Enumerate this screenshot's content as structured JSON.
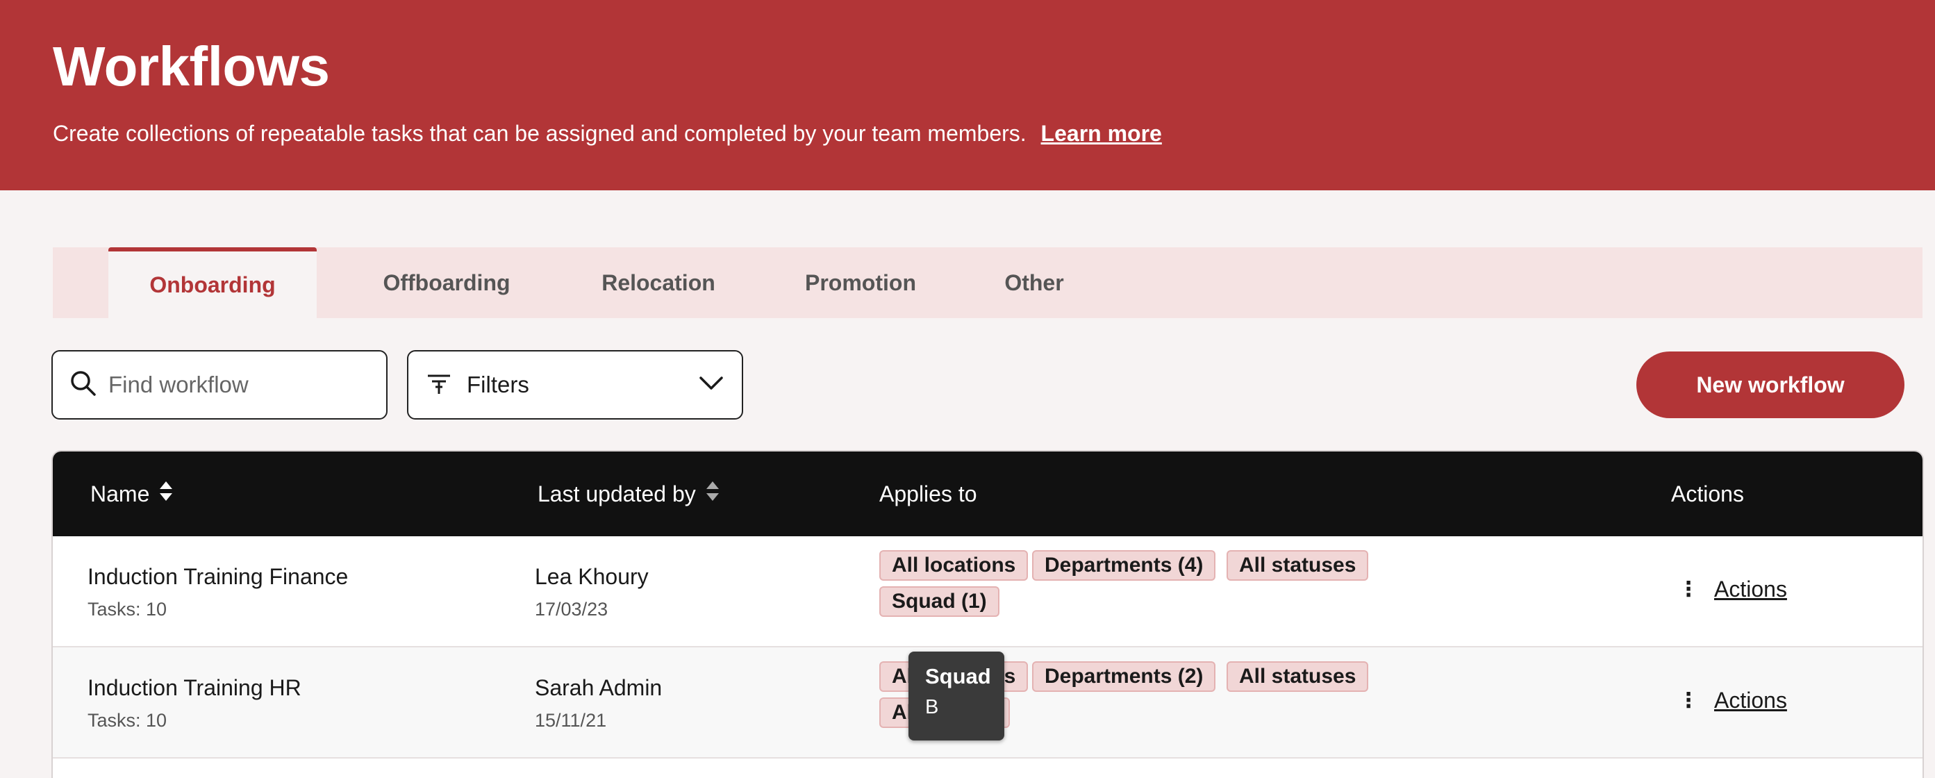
{
  "header": {
    "title": "Workflows",
    "subtitle": "Create collections of repeatable tasks that can be assigned and completed by your team members.",
    "learn_more": "Learn more",
    "bg_color": "#b23537"
  },
  "tabs": [
    {
      "label": "Onboarding",
      "active": true
    },
    {
      "label": "Offboarding",
      "active": false
    },
    {
      "label": "Relocation",
      "active": false
    },
    {
      "label": "Promotion",
      "active": false
    },
    {
      "label": "Other",
      "active": false
    }
  ],
  "toolbar": {
    "search_placeholder": "Find workflow",
    "filters_label": "Filters",
    "new_button": "New workflow"
  },
  "table": {
    "headers": {
      "name": "Name",
      "last_updated": "Last updated by",
      "applies_to": "Applies to",
      "actions": "Actions"
    },
    "rows": [
      {
        "name": "Induction Training Finance",
        "tasks": "Tasks: 10",
        "user": "Lea Khoury",
        "date": "17/03/23",
        "tags": [
          "All locations",
          "Departments (4)",
          "All statuses",
          "Squad (1)"
        ],
        "actions": "Actions"
      },
      {
        "name": "Induction Training HR",
        "tasks": "Tasks: 10",
        "user": "Sarah Admin",
        "date": "15/11/21",
        "tags": [
          "All locations",
          "Departments (2)",
          "All statuses",
          "All squads"
        ],
        "tags_visible": [
          "A",
          "s",
          "Departments (2)",
          "All statuses",
          "A"
        ],
        "actions": "Actions"
      }
    ]
  },
  "tooltip": {
    "title": "Squad",
    "body": "B"
  }
}
